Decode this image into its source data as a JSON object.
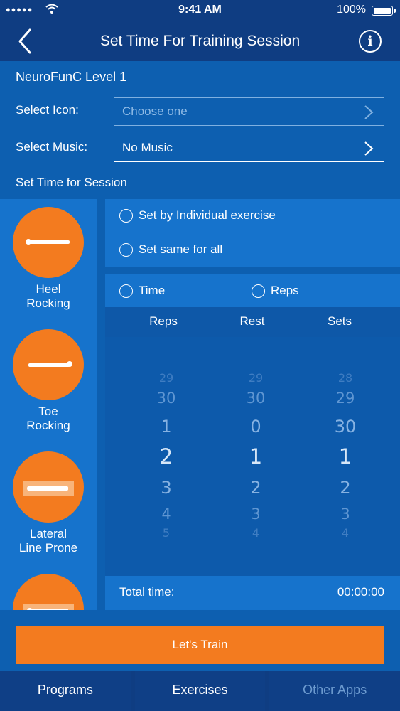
{
  "status_bar": {
    "signal": "●●●●●",
    "time": "9:41 AM",
    "battery": "100%"
  },
  "nav": {
    "title": "Set Time For Training Session",
    "back_icon": "chevron-left-icon",
    "info_icon": "info-icon"
  },
  "form": {
    "level": "NeuroFunC Level 1",
    "icon_label": "Select Icon:",
    "icon_placeholder": "Choose one",
    "music_label": "Select Music:",
    "music_value": "No Music",
    "session_label": "Set Time for Session"
  },
  "exercises": [
    {
      "name_line1": "Heel",
      "name_line2": "Rocking"
    },
    {
      "name_line1": "Toe",
      "name_line2": "Rocking"
    },
    {
      "name_line1": "Lateral",
      "name_line2": "Line Prone"
    },
    {
      "name_line1": "",
      "name_line2": ""
    }
  ],
  "mode_options": {
    "individual": "Set by Individual exercise",
    "same": "Set same for all"
  },
  "type_options": {
    "time": "Time",
    "reps": "Reps"
  },
  "picker": {
    "headers": {
      "reps": "Reps",
      "rest": "Rest",
      "sets": "Sets"
    },
    "reps": [
      "29",
      "30",
      "1",
      "2",
      "3",
      "4",
      "5"
    ],
    "rest": [
      "29",
      "30",
      "0",
      "1",
      "2",
      "3",
      "4"
    ],
    "sets": [
      "28",
      "29",
      "30",
      "1",
      "2",
      "3",
      "4"
    ]
  },
  "total": {
    "label": "Total time:",
    "value": "00:00:00"
  },
  "train_button": "Let's Train",
  "tabs": {
    "programs": "Programs",
    "exercises": "Exercises",
    "other_apps": "Other Apps"
  },
  "colors": {
    "accent": "#f37b1f",
    "background": "#0d5fb0",
    "navbar": "#0f3d82"
  }
}
